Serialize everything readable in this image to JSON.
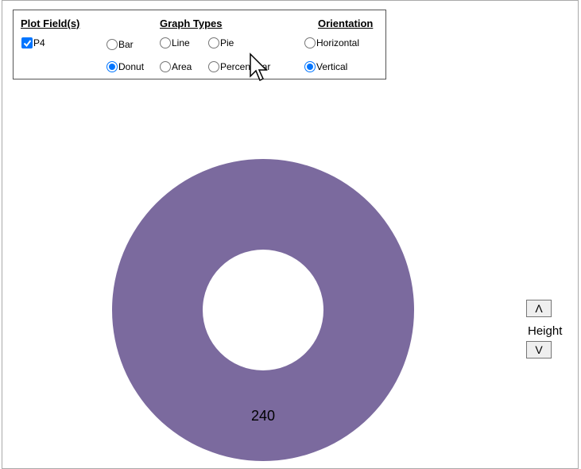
{
  "controls": {
    "plot_fields_header": "Plot Field(s)",
    "plot_fields": [
      {
        "label": "P4",
        "checked": true
      }
    ],
    "graph_types_header": "Graph Types",
    "graph_types": [
      {
        "label": "Bar",
        "selected": false
      },
      {
        "label": "Line",
        "selected": false
      },
      {
        "label": "Pie",
        "selected": false
      },
      {
        "label": "Donut",
        "selected": true
      },
      {
        "label": "Area",
        "selected": false
      },
      {
        "label": "Percent Bar",
        "selected": false
      }
    ],
    "orientation_header": "Orientation",
    "orientation": [
      {
        "label": "Horizontal",
        "selected": false
      },
      {
        "label": "Vertical",
        "selected": true
      }
    ]
  },
  "height_control": {
    "up_label": "Λ",
    "label": "Height",
    "down_label": "V"
  },
  "chart_data": {
    "type": "pie",
    "variant": "donut",
    "slices": [
      {
        "value": 240,
        "label": "240",
        "color": "#7b6a9e"
      }
    ]
  },
  "colors": {
    "accent": "#0075ff",
    "donut": "#7b6a9e"
  }
}
